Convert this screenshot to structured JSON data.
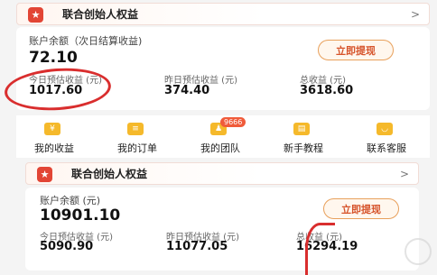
{
  "top": {
    "banner": {
      "title": "联合创始人权益",
      "chevron": ">"
    },
    "balance": {
      "label": "账户余额（次日结算收益)",
      "value": "72.10"
    },
    "withdraw_label": "立即提现",
    "stats": [
      {
        "label": "今日预估收益 (元)",
        "value": "1017.60"
      },
      {
        "label": "昨日预估收益 (元)",
        "value": "374.40"
      },
      {
        "label": "总收益 (元)",
        "value": "3618.60"
      }
    ]
  },
  "menu": [
    {
      "label": "我的收益",
      "icon": "yen-icon",
      "glyph": "¥"
    },
    {
      "label": "我的订单",
      "icon": "order-icon",
      "glyph": "≡"
    },
    {
      "label": "我的团队",
      "icon": "team-icon",
      "glyph": "♟",
      "badge": "9666"
    },
    {
      "label": "新手教程",
      "icon": "tutorial-icon",
      "glyph": "▤"
    },
    {
      "label": "联系客服",
      "icon": "support-icon",
      "glyph": "◡"
    }
  ],
  "bottom": {
    "banner": {
      "title": "联合创始人权益",
      "chevron": ">"
    },
    "balance": {
      "label": "账户余额 (元)",
      "value": "10901.10"
    },
    "withdraw_label": "立即提现",
    "stats": [
      {
        "label": "今日预估收益 (元)",
        "value": "5090.90"
      },
      {
        "label": "昨日预估收益 (元)",
        "value": "11077.05"
      },
      {
        "label": "总收益 (元)",
        "value": "16294.19"
      }
    ]
  },
  "colors": {
    "accent": "#e24535",
    "withdraw_text": "#d6532a",
    "annotation": "#d92e2e",
    "icon_yellow": "#f5b92b"
  }
}
